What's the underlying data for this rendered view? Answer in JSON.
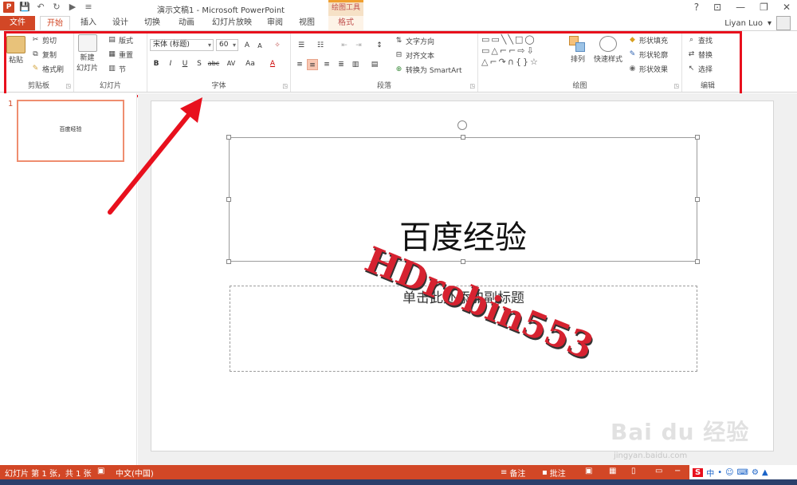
{
  "titlebar": {
    "title": "演示文稿1 - Microsoft PowerPoint",
    "context_header": "绘图工具",
    "help": "?",
    "ribbon_options": "⊡",
    "minimize": "—",
    "restore": "❐",
    "close": "✕"
  },
  "tabs": {
    "file": "文件",
    "home": "开始",
    "insert": "插入",
    "design": "设计",
    "transitions": "切换",
    "animations": "动画",
    "slideshow": "幻灯片放映",
    "review": "审阅",
    "view": "视图",
    "format": "格式"
  },
  "user": {
    "name": "Liyan Luo"
  },
  "ribbon": {
    "clipboard": {
      "label": "剪贴板",
      "paste": "粘贴",
      "cut": "剪切",
      "copy": "复制",
      "format_painter": "格式刷"
    },
    "slides": {
      "label": "幻灯片",
      "new_slide_1": "新建",
      "new_slide_2": "幻灯片",
      "layout": "版式",
      "reset": "重置",
      "section": "节"
    },
    "font": {
      "label": "字体",
      "font_name": "宋体 (标题)",
      "font_size": "60",
      "bold": "B",
      "italic": "I",
      "underline": "U",
      "shadow": "S",
      "strike": "abc",
      "spacing": "AV",
      "case": "Aa",
      "color": "A",
      "grow": "A",
      "shrink": "A"
    },
    "paragraph": {
      "label": "段落",
      "text_direction": "文字方向",
      "align_text": "对齐文本",
      "smartart": "转换为 SmartArt"
    },
    "drawing": {
      "label": "绘图",
      "arrange": "排列",
      "quick_styles": "快速样式",
      "shape_fill": "形状填充",
      "shape_outline": "形状轮廓",
      "shape_effects": "形状效果"
    },
    "editing": {
      "label": "编辑",
      "find": "查找",
      "replace": "替换",
      "select": "选择"
    }
  },
  "thumbs": {
    "number": "1",
    "text": "百度经验"
  },
  "slide": {
    "title": "百度经验",
    "subtitle_placeholder": "单击此处添加副标题"
  },
  "watermarks": {
    "robin": "HDrobin553",
    "baidu": "Bai du 经验",
    "url": "jingyan.baidu.com"
  },
  "status": {
    "slide_info": "幻灯片 第 1 张，共 1 张",
    "language": "中文(中国)",
    "notes": "备注",
    "comments": "批注"
  },
  "ime": {
    "logo": "S",
    "mode": "中"
  },
  "colors": {
    "accent": "#d24726",
    "highlight": "#e8101d",
    "context": "#f0a030"
  }
}
